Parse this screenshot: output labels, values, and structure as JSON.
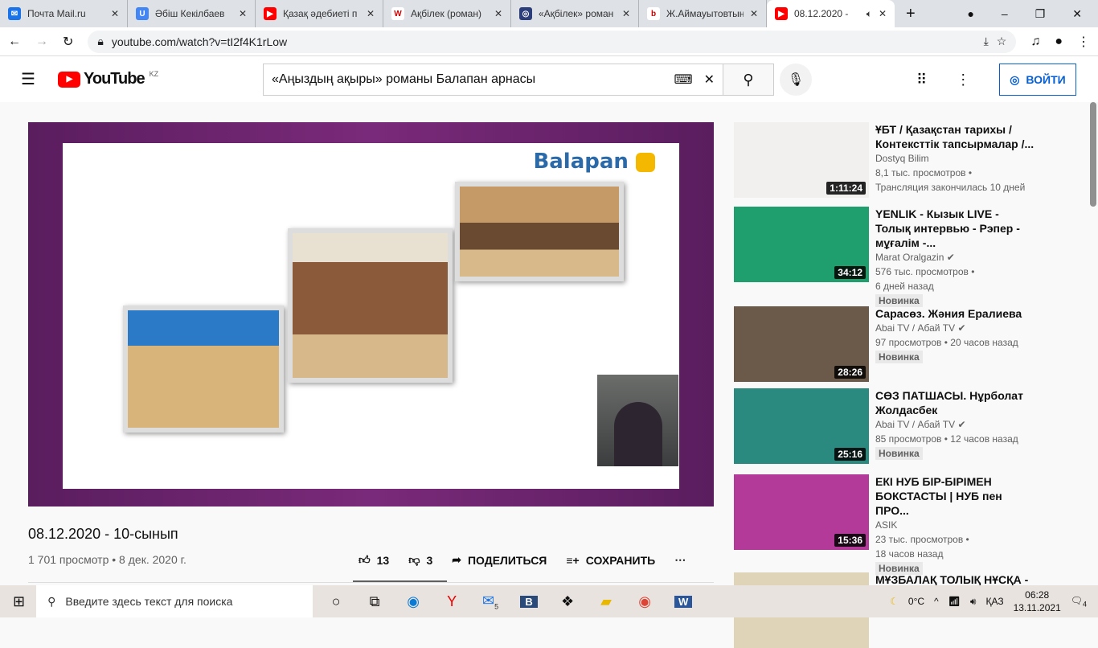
{
  "browser": {
    "tabs": [
      {
        "title": "Почта Mail.ru",
        "color": "#1a73e8",
        "glyph": "✉"
      },
      {
        "title": "Әбіш Кекілбаев",
        "color": "#4285f4",
        "glyph": "U"
      },
      {
        "title": "Қазақ әдебиеті п",
        "color": "#ff0000",
        "glyph": "▶"
      },
      {
        "title": "Ақбілек (роман)",
        "color": "#ffffff",
        "glyph": "W"
      },
      {
        "title": "«Ақбілек» роман",
        "color": "#2c3e7a",
        "glyph": "◎"
      },
      {
        "title": "Ж.Аймауытовтың",
        "color": "#ffffff",
        "glyph": "b"
      },
      {
        "title": "08.12.2020 -",
        "color": "#ff0000",
        "glyph": "▶"
      }
    ],
    "new_tab": "+",
    "url": "youtube.com/watch?v=tI2f4K1rLow"
  },
  "youtube": {
    "logo": "YouTube",
    "region": "KZ",
    "search_query": "«Аңыздың ақыры» романы Балапан арнасы",
    "login": "ВОЙТИ"
  },
  "video": {
    "brand": "Balapan",
    "title": "08.12.2020 - 10-сынып",
    "views": "1 701 просмотр • 8 дек. 2020 г.",
    "likes": "13",
    "dislikes": "3",
    "share": "ПОДЕЛИТЬСЯ",
    "save": "СОХРАНИТЬ"
  },
  "related": [
    {
      "title": "ҰБТ / Қазақстан тарихы / Контексттік тапсырмалар /...",
      "channel": "Dostyq Bilim",
      "stats": "8,1 тыс. просмотров •",
      "stats2": "Трансляция закончилась 10 дней",
      "duration": "1:11:24",
      "badge": "",
      "verified": false,
      "bg": "#f2efef"
    },
    {
      "title": "YENLIK - Кызык LIVE - Толық интервью - Рэпер - мұғалім -...",
      "channel": "Marat Oralgazin",
      "stats": "576 тыс. просмотров •",
      "stats2": "6 дней назад",
      "duration": "34:12",
      "badge": "Новинка",
      "verified": true,
      "bg": "#1f9e6e"
    },
    {
      "title": "Сарасөз. Жәния Ералиева",
      "channel": "Abai TV / Абай TV",
      "stats": "97 просмотров • 20 часов назад",
      "stats2": "",
      "duration": "28:26",
      "badge": "Новинка",
      "verified": true,
      "bg": "#6b5a4a"
    },
    {
      "title": "СӨЗ ПАТШАСЫ. Нұрболат Жолдасбек",
      "channel": "Abai TV / Абай TV",
      "stats": "85 просмотров • 12 часов назад",
      "stats2": "",
      "duration": "25:16",
      "badge": "Новинка",
      "verified": true,
      "bg": "#2a8a80"
    },
    {
      "title": "ЕКІ НУБ БІР-БІРІМЕН БОКСТАСТЫ | НУБ пен ПРО...",
      "channel": "ASIK",
      "stats": "23 тыс. просмотров •",
      "stats2": "18 часов назад",
      "duration": "15:36",
      "badge": "Новинка",
      "verified": false,
      "bg": "#b43a9a"
    },
    {
      "title": "МҰЗБАЛАҚ ТОЛЫҚ НҰСҚА -",
      "channel": "",
      "stats": "",
      "stats2": "",
      "duration": "",
      "badge": "",
      "verified": false,
      "bg": "#e0d4b8"
    }
  ],
  "taskbar": {
    "search_placeholder": "Введите здесь текст для поиска",
    "mail_count": "5",
    "weather": "0°C",
    "lang": "ҚАЗ",
    "time": "06:28",
    "date": "13.11.2021",
    "notifications": "4"
  }
}
